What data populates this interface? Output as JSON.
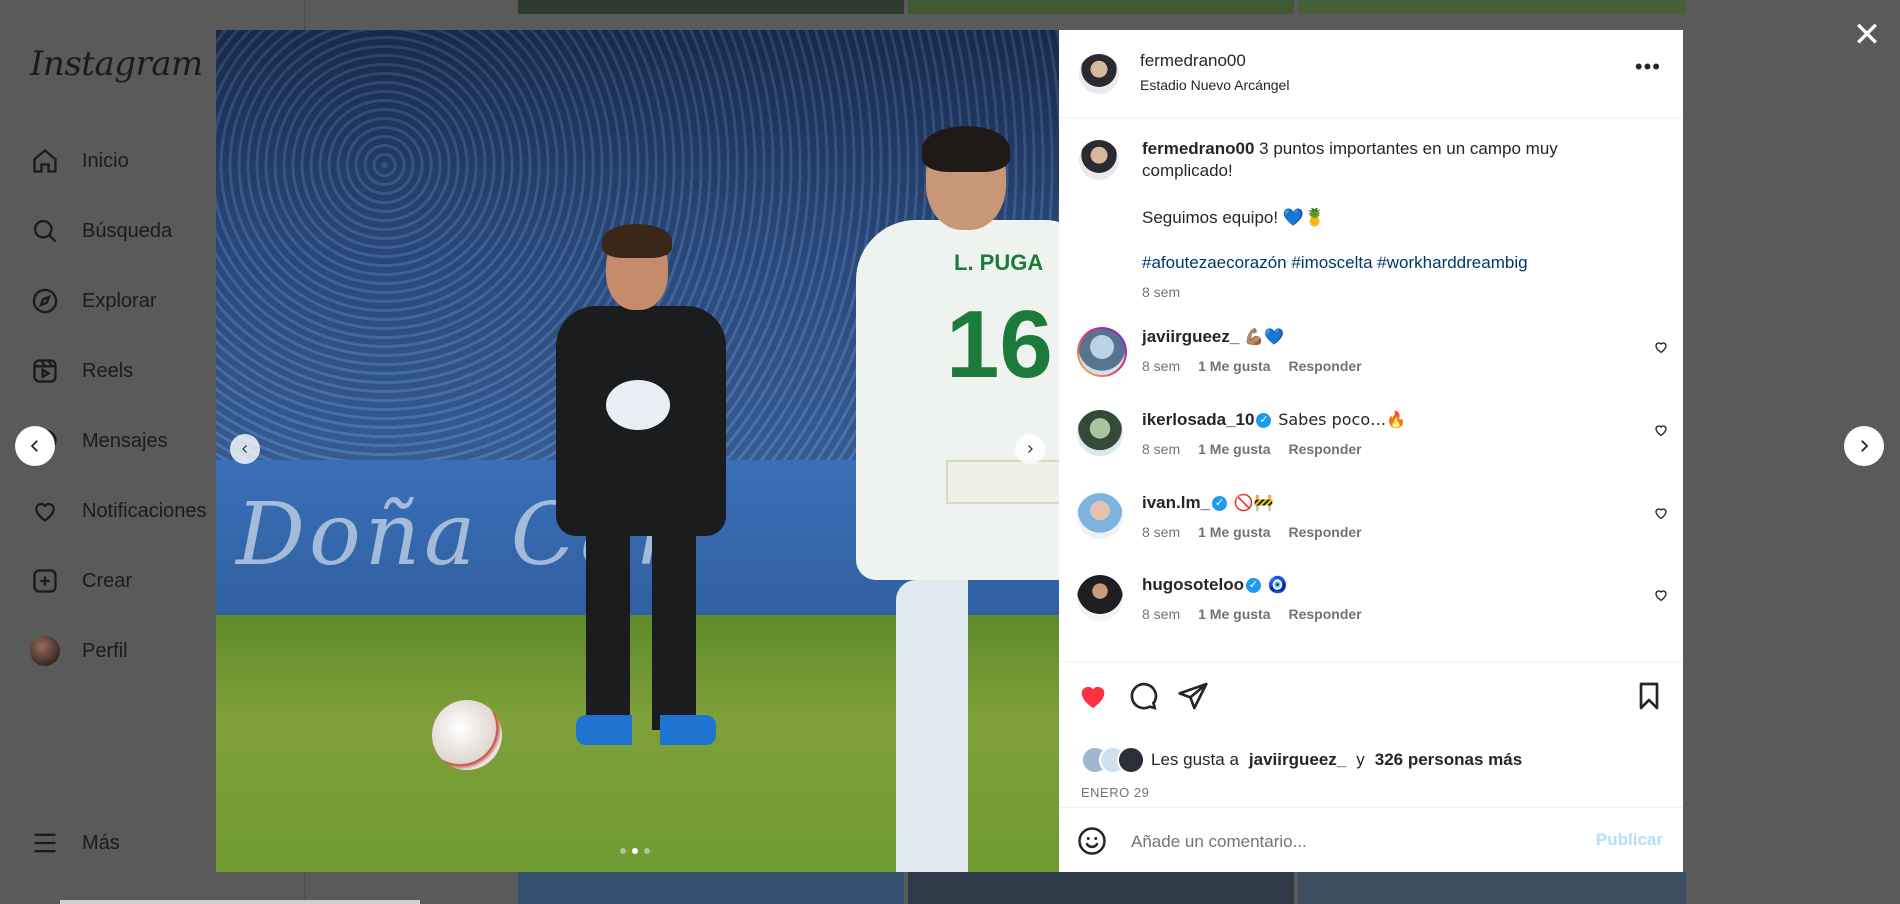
{
  "app": {
    "logo": "Instagram"
  },
  "sidebar": {
    "items": [
      {
        "label": "Inicio",
        "icon": "home-icon"
      },
      {
        "label": "Búsqueda",
        "icon": "search-icon"
      },
      {
        "label": "Explorar",
        "icon": "compass-icon"
      },
      {
        "label": "Reels",
        "icon": "reels-icon"
      },
      {
        "label": "Mensajes",
        "icon": "messenger-icon"
      },
      {
        "label": "Notificaciones",
        "icon": "heart-icon"
      },
      {
        "label": "Crear",
        "icon": "plus-square-icon"
      },
      {
        "label": "Perfil",
        "icon": "profile-avatar"
      }
    ],
    "more_label": "Más"
  },
  "post": {
    "username": "fermedrano00",
    "location": "Estadio Nuevo Arcángel",
    "media": {
      "banner_text": "Doña Car",
      "player_number": "16",
      "player_name": "L. PUGA",
      "carousel_index": 2,
      "carousel_count": 3
    },
    "caption": {
      "username": "fermedrano00",
      "text": "3 puntos importantes en un campo muy complicado!",
      "line2": "Seguimos equipo! 💙🍍",
      "hashtags": "#afoutezaecorazón #imoscelta #workharddreambig",
      "time": "8 sem"
    },
    "comments": [
      {
        "username": "javiirgueez_",
        "verified": false,
        "text": "💪🏽💙",
        "time": "8 sem",
        "likes": "1 Me gusta",
        "reply": "Responder"
      },
      {
        "username": "ikerlosada_10",
        "verified": true,
        "text": "Sabes poco…🔥",
        "time": "8 sem",
        "likes": "1 Me gusta",
        "reply": "Responder"
      },
      {
        "username": "ivan.lm_",
        "verified": true,
        "text": "🚫🚧",
        "time": "8 sem",
        "likes": "1 Me gusta",
        "reply": "Responder"
      },
      {
        "username": "hugosoteloo",
        "verified": true,
        "text": "🧿",
        "time": "8 sem",
        "likes": "1 Me gusta",
        "reply": "Responder"
      }
    ],
    "likes": {
      "prefix": "Les gusta a",
      "user": "javiirgueez_",
      "joiner": "y",
      "others": "326 personas más"
    },
    "date": "ENERO 29",
    "comment_input": {
      "placeholder": "Añade un comentario..."
    },
    "publish_label": "Publicar"
  },
  "colors": {
    "like_red": "#ff3040",
    "link_blue": "#00376b",
    "publish_disabled": "#b2dffc"
  }
}
